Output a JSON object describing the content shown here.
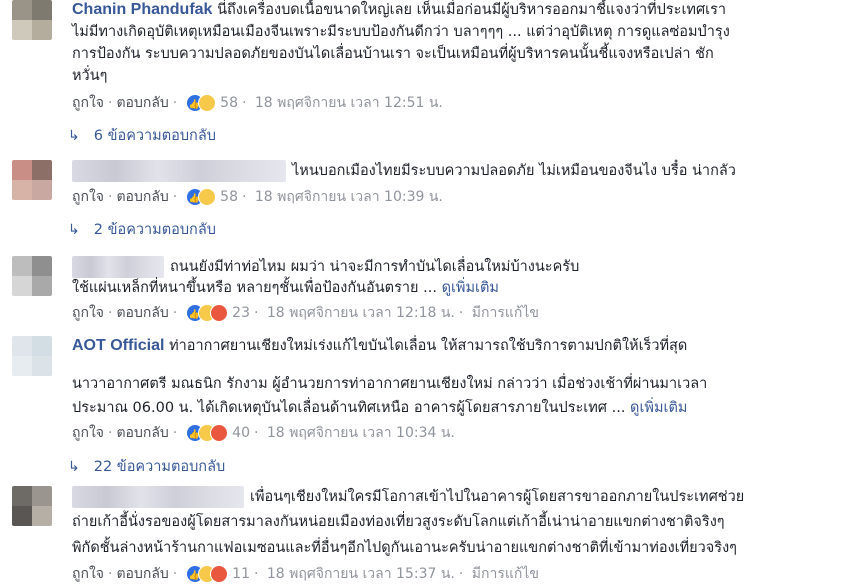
{
  "comments": [
    {
      "author": "Chanin Phandufak",
      "lines": [
        "นี่ถึงเครื่องบดเนื้อขนาดใหญ่เลย เห็นเมื่อก่อนมีผู้บริหารออกมาชี้แจงว่าที่ประเทศเรา",
        "ไม่มีทางเกิดอุบัติเหตุเหมือนเมืองจีนเพราะมีระบบป้องกันดีกว่า บลาๆๆๆ ... แต่ว่าอุบัติเหตุ การดูแลซ่อมบำรุง",
        "การป้องกัน ระบบความปลอดภัยของบันไดเลื่อนบ้านเรา จะเป็นเหมือนที่ผู้บริหารคนนั้นชี้แจงหรือเปล่า ชัก",
        "หวั่นๆ"
      ],
      "like": "ถูกใจ",
      "reply": "ตอบกลับ",
      "reaction_count": "58",
      "timestamp": "18 พฤศจิกายน เวลา 12:51 น.",
      "replies_label": "6 ข้อความตอบกลับ"
    },
    {
      "author": "",
      "lines": [
        "ไหนบอกเมืองไทยมีระบบความปลอดภัย ไม่เหมือนของจีนไง บรื๋อ น่ากลัว"
      ],
      "like": "ถูกใจ",
      "reply": "ตอบกลับ",
      "reaction_count": "58",
      "timestamp": "18 พฤศจิกายน เวลา 10:39 น.",
      "replies_label": "2 ข้อความตอบกลับ"
    },
    {
      "author": "",
      "lines": [
        "ถนนยังมีท่าท่อไหม ผมว่า น่าจะมีการทำบันไดเลื่อนใหม่บ้างนะครับ",
        "ใช้แผ่นเหล็กที่หนาขึ้นหรือ หลายๆชั้นเพื่อป้องกันอันตราย ..."
      ],
      "see_more": "ดูเพิ่มเติม",
      "like": "ถูกใจ",
      "reply": "ตอบกลับ",
      "reaction_count": "23",
      "timestamp": "18 พฤศจิกายน เวลา 12:18 น.",
      "edited": "มีการแก้ไข"
    },
    {
      "author": "AOT Official",
      "lines": [
        "ท่าอากาศยานเชียงใหม่เร่งแก้ไขบันไดเลื่อน ให้สามารถใช้บริการตามปกติให้เร็วที่สุด",
        "",
        "นาวาอากาศตรี มณธนิก รักงาม ผู้อำนวยการท่าอากาศยานเชียงใหม่ กล่าวว่า เมื่อช่วงเช้าที่ผ่านมาเวลา",
        "ประมาณ 06.00 น. ได้เกิดเหตุบันไดเลื่อนด้านทิศเหนือ อาคารผู้โดยสารภายในประเทศ ..."
      ],
      "see_more": "ดูเพิ่มเติม",
      "like": "ถูกใจ",
      "reply": "ตอบกลับ",
      "reaction_count": "40",
      "timestamp": "18 พฤศจิกายน เวลา 10:34 น.",
      "replies_label": "22 ข้อความตอบกลับ"
    },
    {
      "author": "",
      "lines": [
        "เพื่อนๆเชียงใหม่ใครมีโอกาสเข้าไปในอาคารผู้โดยสารขาออกภายในประเทศช่วย",
        "ถ่ายเก้าอี้นั่งรอของผู้โดยสารมาลงกันหน่อยเมืองท่องเที่ยวสูงระดับโลกแต่เก้าอี้เน่าน่าอายแขกต่างชาติจริงๆ",
        "พิกัดชั้นล่างหน้าร้านกาแฟอเมซอนและที่อื่นๆอีกไปดูกันเอานะครับน่าอายแขกต่างชาติที่เข้ามาท่องเที่ยวจริงๆ"
      ],
      "like": "ถูกใจ",
      "reply": "ตอบกลับ",
      "reaction_count": "11",
      "timestamp": "18 พฤศจิกายน เวลา 15:37 น.",
      "edited": "มีการแก้ไข"
    }
  ],
  "colors": {
    "link": "#385898",
    "meta": "#90949c",
    "text": "#1d2129",
    "like_reaction": "#2f6fe4",
    "haha_reaction": "#f7c94a",
    "angry_reaction": "#e9573f"
  },
  "icons": [
    "like-reaction-icon",
    "haha-reaction-icon",
    "angry-reaction-icon",
    "reply-arrow-icon"
  ]
}
